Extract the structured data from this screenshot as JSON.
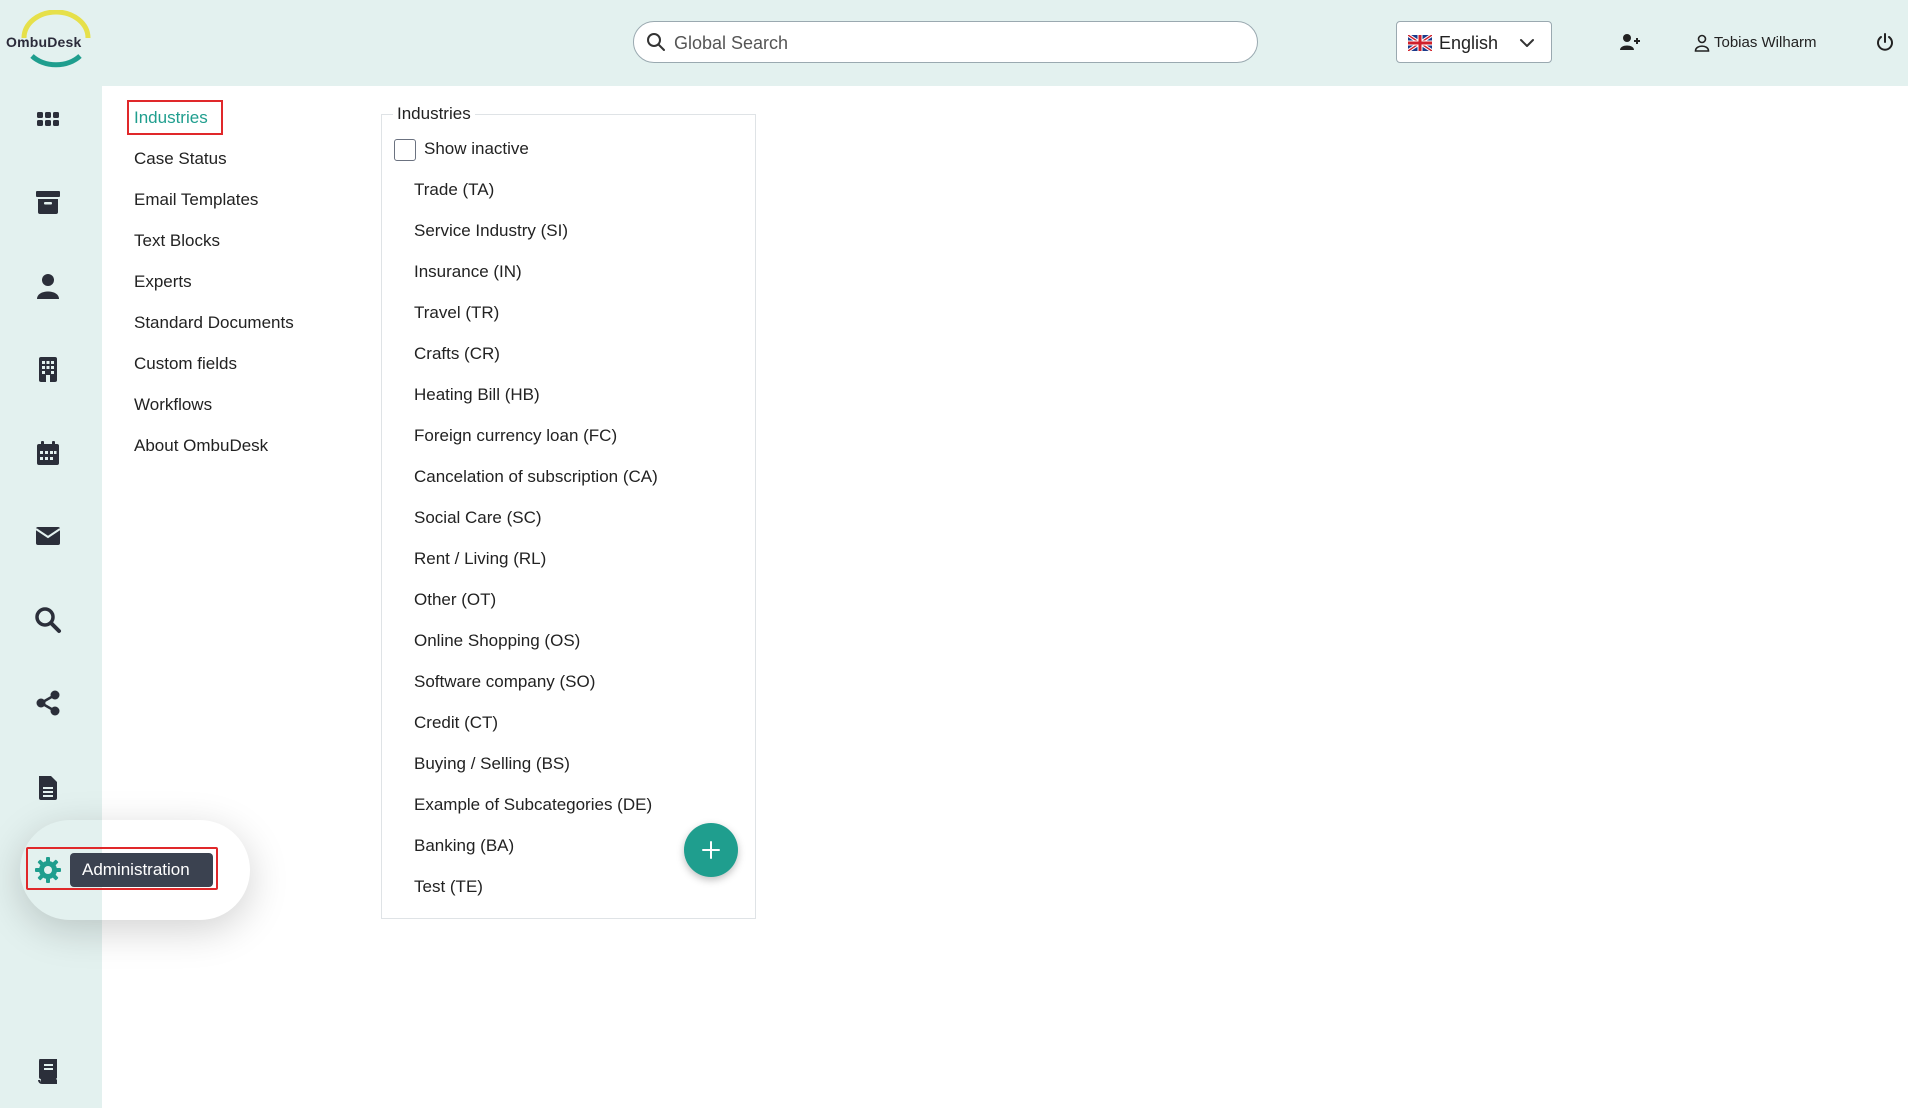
{
  "brand": {
    "name": "OmbuDesk",
    "accent_color": "#1f9e8e",
    "highlight_color": "#e0282a"
  },
  "header": {
    "search_placeholder": "Global Search",
    "language": "English",
    "user_name": "Tobias Wilharm"
  },
  "leftnav": {
    "items": [
      {
        "icon": "apps-grid-icon"
      },
      {
        "icon": "archive-icon"
      },
      {
        "icon": "person-icon"
      },
      {
        "icon": "building-icon"
      },
      {
        "icon": "calendar-icon"
      },
      {
        "icon": "envelope-icon"
      },
      {
        "icon": "search-icon"
      },
      {
        "icon": "share-icon"
      },
      {
        "icon": "document-icon"
      },
      {
        "icon": "gear-icon",
        "active": true
      },
      {
        "icon": "book-icon"
      }
    ],
    "tooltip": "Administration"
  },
  "submenu": {
    "items": [
      {
        "label": "Industries",
        "active": true
      },
      {
        "label": "Case Status"
      },
      {
        "label": "Email Templates"
      },
      {
        "label": "Text Blocks"
      },
      {
        "label": "Experts"
      },
      {
        "label": "Standard Documents"
      },
      {
        "label": "Custom fields"
      },
      {
        "label": "Workflows"
      },
      {
        "label": "About OmbuDesk"
      }
    ]
  },
  "industries": {
    "title": "Industries",
    "show_inactive_label": "Show inactive",
    "show_inactive_checked": false,
    "items": [
      "Trade (TA)",
      "Service Industry (SI)",
      "Insurance (IN)",
      "Travel (TR)",
      "Crafts (CR)",
      "Heating Bill (HB)",
      "Foreign currency loan (FC)",
      "Cancelation of subscription (CA)",
      "Social Care (SC)",
      "Rent / Living (RL)",
      "Other (OT)",
      "Online Shopping (OS)",
      "Software company (SO)",
      "Credit (CT)",
      "Buying / Selling (BS)",
      "Example of Subcategories (DE)",
      "Banking (BA)",
      "Test (TE)"
    ]
  }
}
